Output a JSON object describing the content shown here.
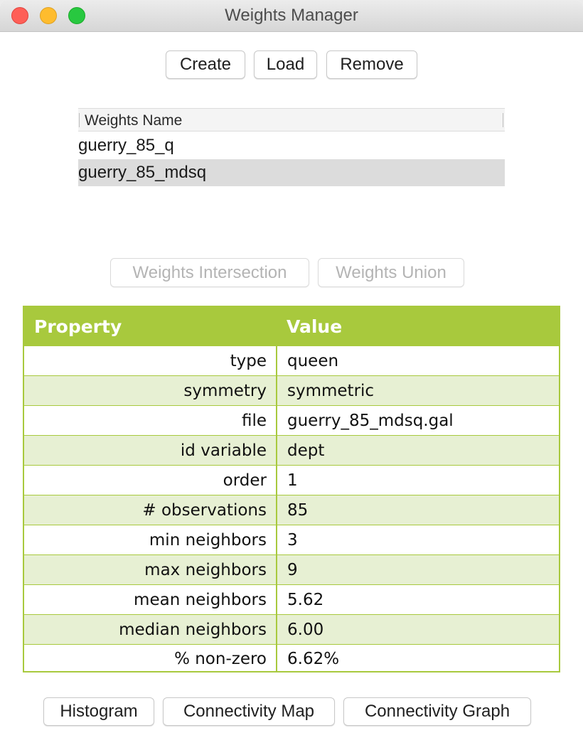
{
  "window": {
    "title": "Weights Manager"
  },
  "toolbar": {
    "create_label": "Create",
    "load_label": "Load",
    "remove_label": "Remove"
  },
  "weights_list": {
    "header": "Weights Name",
    "items": [
      "guerry_85_q",
      "guerry_85_mdsq"
    ],
    "selected": "guerry_85_mdsq"
  },
  "set_ops": {
    "intersection_label": "Weights Intersection",
    "union_label": "Weights Union"
  },
  "properties": {
    "header_property": "Property",
    "header_value": "Value",
    "rows": [
      {
        "key": "type",
        "value": "queen"
      },
      {
        "key": "symmetry",
        "value": "symmetric"
      },
      {
        "key": "file",
        "value": "guerry_85_mdsq.gal"
      },
      {
        "key": "id variable",
        "value": "dept"
      },
      {
        "key": "order",
        "value": "1"
      },
      {
        "key": "# observations",
        "value": "85"
      },
      {
        "key": "min neighbors",
        "value": "3"
      },
      {
        "key": "max neighbors",
        "value": "9"
      },
      {
        "key": "mean neighbors",
        "value": "5.62"
      },
      {
        "key": "median neighbors",
        "value": "6.00"
      },
      {
        "key": "% non-zero",
        "value": "6.62%"
      }
    ]
  },
  "bottom_buttons": {
    "histogram_label": "Histogram",
    "connectivity_map_label": "Connectivity Map",
    "connectivity_graph_label": "Connectivity Graph"
  },
  "colors": {
    "table_accent": "#a8c93d",
    "table_alt_row": "#e7f0d3",
    "selection": "#dcdcdc"
  }
}
